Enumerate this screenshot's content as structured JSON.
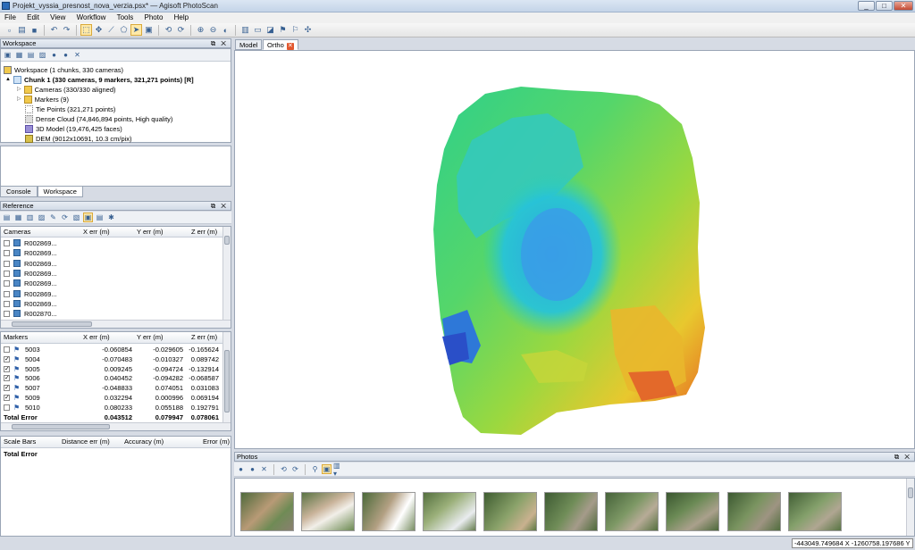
{
  "window": {
    "title": "Projekt_vyssia_presnost_nova_verzia.psx* — Agisoft PhotoScan",
    "minimize": "_",
    "maximize": "□",
    "close": "✕"
  },
  "menu": [
    "File",
    "Edit",
    "View",
    "Workflow",
    "Tools",
    "Photo",
    "Help"
  ],
  "workspace": {
    "title": "Workspace",
    "root": "Workspace (1 chunks, 330 cameras)",
    "chunk": "Chunk 1 (330 cameras, 9 markers, 321,271 points) [R]",
    "items": [
      "Cameras (330/330 aligned)",
      "Markers (9)",
      "Tie Points (321,271 points)",
      "Dense Cloud (74,846,894 points, High quality)",
      "3D Model (19,476,425 faces)",
      "DEM (9012x10691, 10.3 cm/pix)"
    ]
  },
  "bottom_tabs": [
    "Console",
    "Workspace"
  ],
  "reference": {
    "title": "Reference",
    "cameras_header": [
      "Cameras",
      "X err (m)",
      "Y err (m)",
      "Z err (m)"
    ],
    "cameras": [
      "R002869...",
      "R002869...",
      "R002869...",
      "R002869...",
      "R002869...",
      "R002869...",
      "R002869...",
      "R002870..."
    ],
    "markers_header": [
      "Markers",
      "X err (m)",
      "Y err (m)",
      "Z err (m)"
    ],
    "markers": [
      {
        "name": "5003",
        "checked": false,
        "x": "-0.060854",
        "y": "-0.029605",
        "z": "-0.165624"
      },
      {
        "name": "5004",
        "checked": true,
        "x": "-0.070483",
        "y": "-0.010327",
        "z": "0.089742"
      },
      {
        "name": "5005",
        "checked": true,
        "x": "0.009245",
        "y": "-0.094724",
        "z": "-0.132914"
      },
      {
        "name": "5006",
        "checked": true,
        "x": "0.040452",
        "y": "-0.094282",
        "z": "-0.068587"
      },
      {
        "name": "5007",
        "checked": true,
        "x": "-0.048833",
        "y": "0.074051",
        "z": "0.031083"
      },
      {
        "name": "5009",
        "checked": true,
        "x": "0.032294",
        "y": "0.000996",
        "z": "0.069194"
      },
      {
        "name": "5010",
        "checked": false,
        "x": "0.080233",
        "y": "0.055188",
        "z": "0.192791"
      }
    ],
    "total": {
      "label": "Total Error",
      "x": "0.043512",
      "y": "0.079947",
      "z": "0.078061"
    },
    "scale_header": [
      "Scale Bars",
      "Distance err (m)",
      "Accuracy (m)",
      "Error (m)"
    ],
    "scale_total": "Total Error"
  },
  "view_tabs": {
    "model": "Model",
    "ortho": "Ortho"
  },
  "photos": {
    "title": "Photos"
  },
  "status": {
    "coords": "-443049.749684 X  -1260758.197686 Y"
  },
  "icons": {
    "checked": "✓"
  }
}
